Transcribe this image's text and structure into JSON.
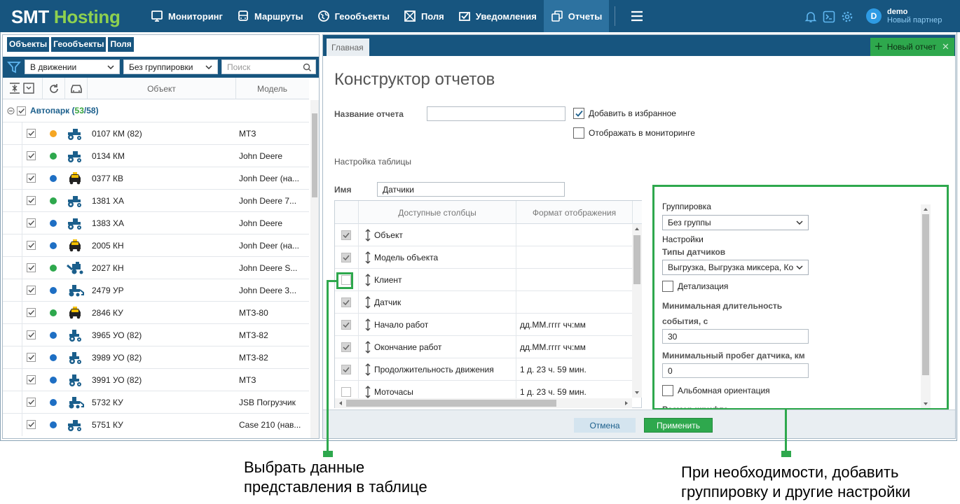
{
  "app": {
    "logo_part1": "SMT",
    "logo_part2": "Hosting"
  },
  "nav": [
    {
      "label": "Мониторинг",
      "icon": "monitor-icon"
    },
    {
      "label": "Маршруты",
      "icon": "route-icon"
    },
    {
      "label": "Геообъекты",
      "icon": "geo-icon"
    },
    {
      "label": "Поля",
      "icon": "field-icon"
    },
    {
      "label": "Уведомления",
      "icon": "notification-icon"
    },
    {
      "label": "Отчеты",
      "icon": "reports-icon",
      "active": true
    }
  ],
  "user": {
    "initial": "D",
    "name": "demo",
    "role": "Новый партнер"
  },
  "left": {
    "tabs": [
      "Объекты",
      "Геообъекты",
      "Поля"
    ],
    "filter_state": "В движении",
    "grouping": "Без группировки",
    "search_placeholder": "Поиск",
    "col_object": "Объект",
    "col_model": "Модель",
    "group_name": "Автопарк (",
    "group_count_active": "53",
    "group_count_total": "/58)",
    "rows": [
      {
        "obj": "0107 КМ (82)",
        "model": "МТЗ",
        "color": "#f5a623",
        "veh": "tractor"
      },
      {
        "obj": "0134 КМ",
        "model": "John Deere",
        "color": "#2ea84d",
        "veh": "tractor"
      },
      {
        "obj": "0377 КВ",
        "model": "Jonh Deer (на...",
        "color": "#1e6fc4",
        "veh": "taxi"
      },
      {
        "obj": "1381 ХА",
        "model": "Jonh Deere 7...",
        "color": "#2ea84d",
        "veh": "tractor"
      },
      {
        "obj": "1383 ХА",
        "model": "John Deere",
        "color": "#1e6fc4",
        "veh": "tractor"
      },
      {
        "obj": "2005 КН",
        "model": "Jonh Deer (на...",
        "color": "#1e6fc4",
        "veh": "taxi"
      },
      {
        "obj": "2027 КН",
        "model": "John Deere S...",
        "color": "#2ea84d",
        "veh": "harvester"
      },
      {
        "obj": "2479 УР",
        "model": "John Deere 3...",
        "color": "#1e6fc4",
        "veh": "loader"
      },
      {
        "obj": "2846 КУ",
        "model": "МТЗ-80",
        "color": "#2ea84d",
        "veh": "taxi"
      },
      {
        "obj": "3965 УО (82)",
        "model": "МТЗ-82",
        "color": "#1e6fc4",
        "veh": "tractor-small"
      },
      {
        "obj": "3989 УО (82)",
        "model": "МТЗ-82",
        "color": "#1e6fc4",
        "veh": "tractor-small"
      },
      {
        "obj": "3991 УО (82)",
        "model": "МТЗ",
        "color": "#1e6fc4",
        "veh": "tractor-small"
      },
      {
        "obj": "5732 КУ",
        "model": "JSB Погрузчик",
        "color": "#1e6fc4",
        "veh": "loader"
      },
      {
        "obj": "5751 КУ",
        "model": "Case 210 (нав...",
        "color": "#1e6fc4",
        "veh": "tractor"
      }
    ]
  },
  "right": {
    "tab": "Главная",
    "new_report": "Новый отчет",
    "title": "Конструктор отчетов",
    "report_name_label": "Название отчета",
    "report_name_value": "",
    "fav_label": "Добавить в избранное",
    "monitor_label": "Отображать в мониторинге",
    "table_setup_label": "Настройка таблицы",
    "name_label": "Имя",
    "name_value": "Датчики",
    "col_available": "Доступные столбцы",
    "col_format": "Формат отображения",
    "columns": [
      {
        "name": "Объект",
        "fmt": "",
        "checked": true
      },
      {
        "name": "Модель объекта",
        "fmt": "",
        "checked": true
      },
      {
        "name": "Клиент",
        "fmt": "",
        "checked": false
      },
      {
        "name": "Датчик",
        "fmt": "",
        "checked": true
      },
      {
        "name": "Начало работ",
        "fmt": "дд.ММ.гггг чч:мм",
        "checked": true
      },
      {
        "name": "Окончание работ",
        "fmt": "дд.ММ.гггг чч:мм",
        "checked": true
      },
      {
        "name": "Продолжительность движения",
        "fmt": "1 д. 23 ч. 59 мин.",
        "checked": true
      },
      {
        "name": "Моточасы",
        "fmt": "1 д. 23 ч. 59 мин.",
        "checked": false
      }
    ],
    "settings": {
      "grouping_label": "Группировка",
      "grouping_value": "Без группы",
      "settings_label": "Настройки",
      "sensor_types_label": "Типы датчиков",
      "sensor_types_value": "Выгрузка, Выгрузка миксера, Ко",
      "detail_label": "Детализация",
      "min_duration_label_1": "Минимальная длительность",
      "min_duration_label_2": "события, с",
      "min_duration_value": "30",
      "min_mileage_label": "Минимальный пробег датчика, км",
      "min_mileage_value": "0",
      "landscape_label": "Альбомная ориентация",
      "font_size_label": "Размер шрифта"
    },
    "cancel": "Отмена",
    "apply": "Применить"
  },
  "captions": {
    "left_1": "Выбрать данные",
    "left_2": "представления в таблице",
    "right_1": "При необходимости, добавить",
    "right_2": "группировку и другие настройки"
  },
  "colors": {
    "primary": "#17557f",
    "accent": "#2ea84d"
  }
}
